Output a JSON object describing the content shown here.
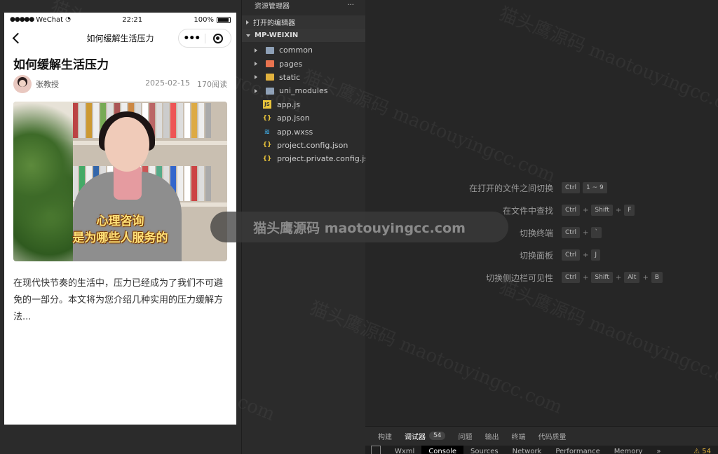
{
  "simulator": {
    "status": {
      "carrier": "WeChat",
      "time": "22:21",
      "battery": "100%"
    },
    "nav_title": "如何缓解生活压力",
    "article": {
      "title": "如何缓解生活压力",
      "author": "张教授",
      "date": "2025-02-15",
      "views": "170阅读",
      "cover_caption_1": "心理咨询",
      "cover_caption_2": "是为哪些人服务的",
      "summary": "在现代快节奏的生活中，压力已经成为了我们不可避免的一部分。本文将为您介绍几种实用的压力缓解方法..."
    }
  },
  "explorer": {
    "header_title": "资源管理器",
    "header_more": "···",
    "open_editors": "打开的编辑器",
    "project": "MP-WEIXIN",
    "folders": [
      {
        "name": "common",
        "color": "#8ea0b6"
      },
      {
        "name": "pages",
        "color": "#e8734f"
      },
      {
        "name": "static",
        "color": "#e2b23e"
      },
      {
        "name": "uni_modules",
        "color": "#8ea0b6"
      }
    ],
    "files": [
      {
        "name": "app.js",
        "icon": "js-icon"
      },
      {
        "name": "app.json",
        "icon": "json-icon"
      },
      {
        "name": "app.wxss",
        "icon": "css-icon"
      },
      {
        "name": "project.config.json",
        "icon": "json-icon"
      },
      {
        "name": "project.private.config.js...",
        "icon": "json-icon"
      }
    ]
  },
  "shortcuts": [
    {
      "label": "在打开的文件之间切换",
      "keys": [
        "Ctrl",
        "1 ~ 9"
      ]
    },
    {
      "label": "在文件中查找",
      "keys": [
        "Ctrl",
        "Shift",
        "F"
      ]
    },
    {
      "label": "切换终端",
      "keys": [
        "Ctrl",
        "`"
      ]
    },
    {
      "label": "切换面板",
      "keys": [
        "Ctrl",
        "J"
      ]
    },
    {
      "label": "切换侧边栏可见性",
      "keys": [
        "Ctrl",
        "Shift",
        "Alt",
        "B"
      ]
    }
  ],
  "panel": {
    "tabs": [
      "构建",
      "调试器",
      "问题",
      "输出",
      "终端",
      "代码质量"
    ],
    "debugger_count": "54",
    "devtools_tabs": [
      "Wxml",
      "Console",
      "Sources",
      "Network",
      "Performance",
      "Memory",
      "»"
    ],
    "warnings": "⚠ 54"
  },
  "watermark": "猫头鹰源码 maotouyingcc.com"
}
